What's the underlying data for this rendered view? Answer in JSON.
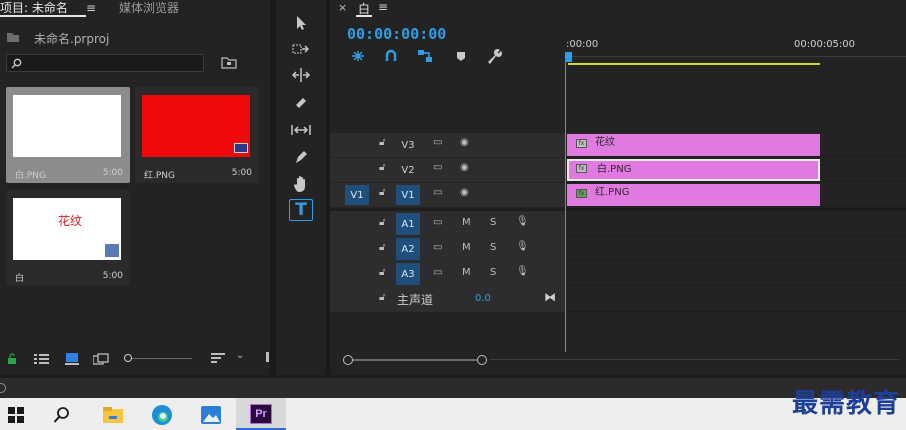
{
  "project_panel": {
    "tab_project": "项目: 未命名",
    "tab_media": "媒体浏览器",
    "title": "未命名.prproj",
    "search_placeholder": "",
    "items": [
      {
        "label": "白.PNG",
        "duration": "5:00",
        "kind": "white"
      },
      {
        "label": "红.PNG",
        "duration": "5:00",
        "kind": "red"
      },
      {
        "label": "白",
        "duration": "5:00",
        "kind": "text",
        "text": "花纹"
      }
    ]
  },
  "timeline": {
    "tab_title": "白",
    "timecode": "00:00:00:00",
    "ruler_labels": [
      ":00:00",
      "00:00:05:00"
    ],
    "video_tracks": [
      {
        "name": "V3",
        "source": "",
        "clip": "花纹"
      },
      {
        "name": "V2",
        "source": "",
        "clip": "白.PNG"
      },
      {
        "name": "V1",
        "source": "V1",
        "clip": "红.PNG"
      }
    ],
    "audio_tracks": [
      {
        "name": "A1",
        "m": "M",
        "s": "S"
      },
      {
        "name": "A2",
        "m": "M",
        "s": "S"
      },
      {
        "name": "A3",
        "m": "M",
        "s": "S"
      }
    ],
    "master": {
      "label": "主声道",
      "value": "0.0"
    }
  },
  "tools": [
    "selection-tool",
    "track-select-tool",
    "ripple-edit-tool",
    "razor-tool",
    "slip-tool",
    "pen-tool",
    "hand-tool",
    "type-tool"
  ],
  "watermark": "最需教育",
  "colors": {
    "accent": "#2e9fe6",
    "clip": "#e07ae0",
    "track_blue": "#1f4f7d",
    "workbar": "#d8d81c"
  }
}
